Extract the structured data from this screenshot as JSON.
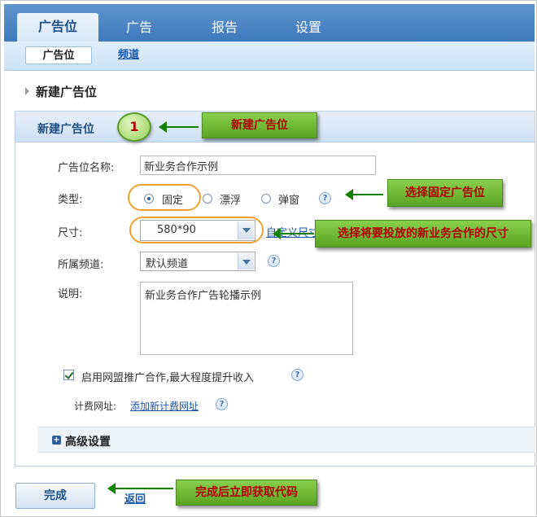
{
  "nav": {
    "tabs": [
      {
        "label": "广告位",
        "active": true
      },
      {
        "label": "广告",
        "active": false
      },
      {
        "label": "报告",
        "active": false
      },
      {
        "label": "设置",
        "active": false
      }
    ],
    "subtabs": [
      {
        "label": "广告位",
        "active": true
      },
      {
        "label": "频道",
        "active": false
      }
    ]
  },
  "breadcrumb": "新建广告位",
  "panel": {
    "title": "新建广告位",
    "name_label": "广告位名称:",
    "name_value": "新业务合作示例",
    "type_label": "类型:",
    "type_options": [
      "固定",
      "漂浮",
      "弹窗"
    ],
    "type_selected": "固定",
    "size_label": "尺寸:",
    "size_value": "580*90",
    "custom_size_link": "自定义尺寸",
    "channel_label": "所属频道:",
    "channel_value": "默认频道",
    "desc_label": "说明:",
    "desc_value": "新业务合作广告轮播示例",
    "alliance_checkbox_label": "启用网盟推广合作,最大程度提升收入",
    "alliance_checked": true,
    "billing_label": "计费网址:",
    "billing_link": "添加新计费网址",
    "advanced_label": "高级设置",
    "help_symbol": "?"
  },
  "footer": {
    "done_label": "完成",
    "back_label": "返回"
  },
  "annotations": {
    "step_number": "1",
    "callout_new": "新建广告位",
    "callout_type": "选择固定广告位",
    "callout_size": "选择将要投放的新业务合作的尺寸",
    "callout_done": "完成后立即获取代码"
  },
  "colors": {
    "nav_blue": "#3e79bb",
    "callout_green": "#5aa322",
    "callout_text": "#b00000",
    "highlight_orange": "#f0a030",
    "arrow_green": "#138000"
  }
}
